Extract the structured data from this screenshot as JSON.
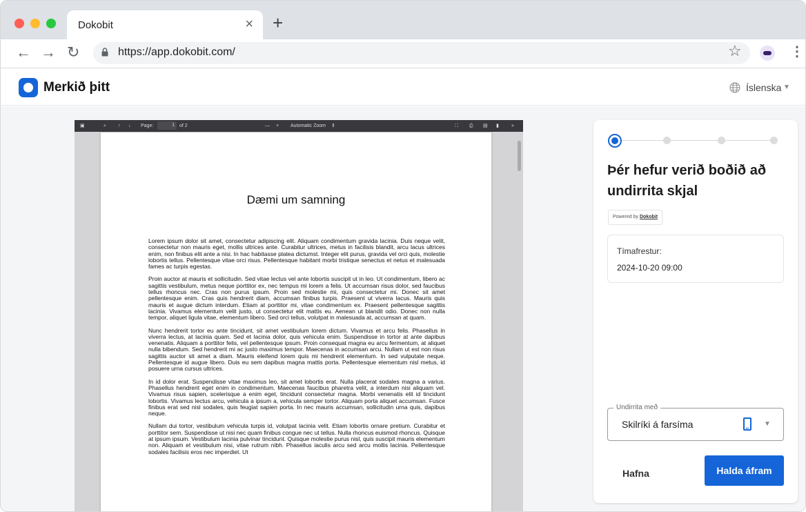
{
  "browser": {
    "tab_title": "Dokobit",
    "tab_close_icon": "close-icon",
    "new_tab_icon": "plus-icon",
    "url": "https://app.dokobit.com/",
    "nav": {
      "back": "←",
      "forward": "→",
      "reload": "↻"
    },
    "star": "☆",
    "menu": "⋮"
  },
  "app": {
    "logo_text": "Merkið þitt",
    "language": "Íslenska"
  },
  "pdf_toolbar": {
    "page_label": "Page:",
    "page_number": "1",
    "page_total": "of 2",
    "zoom_minus": "—",
    "zoom_plus": "+",
    "zoom_label": "Automatic Zoom",
    "more": "»"
  },
  "document": {
    "title": "Dæmi um samning",
    "paragraphs": [
      "Lorem ipsum dolor sit amet, consectetur adipiscing elit. Aliquam condimentum gravida lacinia. Duis neque velit, consectetur non mauris eget, mollis ultrices ante. Curabitur ultrices, metus in facilisis blandit, arcu lacus ultrices enim, non finibus elit ante a nisi. In hac habitasse platea dictumst. Integer elit purus, gravida vel orci quis, molestie lobortis tellus. Pellentesque vitae orci risus. Pellentesque habitant morbi tristique senectus et netus et malesuada fames ac turpis egestas.",
      "Proin auctor at mauris et sollicitudin. Sed vitae lectus vel ante lobortis suscipit ut in leo. Ut condimentum, libero ac sagittis vestibulum, metus neque porttitor ex, nec tempus mi lorem a felis. Ut accumsan risus dolor, sed faucibus tellus rhoncus nec. Cras non purus ipsum. Proin sed molestie mi, quis consectetur mi. Donec sit amet pellentesque enim. Cras quis hendrerit diam, accumsan finibus turpis. Praesent ut viverra lacus. Mauris quis mauris et augue dictum interdum. Etiam at porttitor mi, vitae condimentum ex. Praesent pellentesque sagittis lacinia. Vivamus elementum velit justo, ut consectetur elit mattis eu. Aenean ut blandit odio. Donec non nulla tempor, aliquet ligula vitae, elementum libero. Sed orci tellus, volutpat in malesuada at, accumsan at quam.",
      "Nunc hendrerit tortor eu ante tincidunt, sit amet vestibulum lorem dictum. Vivamus et arcu felis. Phasellus in viverra lectus, at lacinia quam. Sed et lacinia dolor, quis vehicula enim. Suspendisse in tortor at ante dapibus venenatis. Aliquam a porttitor felis, vel pellentesque ipsum. Proin consequat magna eu arcu fermentum, at aliquet nulla bibendum. Sed hendrerit mi ac justo maximus tempor. Maecenas in accumsan arcu. Nullam ut est non risus sagittis auctor sit amet a diam. Mauris eleifend lorem quis mi hendrerit elementum. In sed vulputate neque. Pellentesque id augue libero. Duis eu sem dapibus magna mattis porta. Pellentesque elementum nisl metus, id posuere urna cursus ultrices.",
      "In id dolor erat. Suspendisse vitae maximus leo, sit amet lobortis erat. Nulla placerat sodales magna a varius. Phasellus hendrerit eget enim in condimentum. Maecenas faucibus pharetra velit, a interdum nisi aliquam vel. Vivamus risus sapien, scelerisque a enim eget, tincidunt consectetur magna. Morbi venenatis elit id tincidunt lobortis. Vivamus lectus arcu, vehicula a ipsum a, vehicula semper tortor. Aliquam porta aliquet accumsan. Fusce finibus erat sed nisl sodales, quis feugiat sapien porta. In nec mauris accumsan, sollicitudin urna quis, dapibus neque.",
      "Nullam dui tortor, vestibulum vehicula turpis id, volutpat lacinia velit. Etiam lobortis ornare pretium. Curabitur et porttitor sem. Suspendisse ut nisi nec quam finibus congue nec ut tellus. Nulla rhoncus euismod rhoncus. Quisque at ipsum ipsum. Vestibulum lacinia pulvinar tincidunt. Quisque molestie purus nisl, quis suscipit mauris elementum non. Aliquam et vestibulum nisi, vitae rutrum nibh. Phasellus iaculis arcu sed arcu mollis lacinia. Pellentesque sodales facilisis eros nec imperdiet. Ut"
    ]
  },
  "signing_panel": {
    "title": "Þér hefur verið boðið að undirrita skjal",
    "powered_by": "Powered by",
    "powered_brand": "Dokobit",
    "deadline_label": "Tímafrestur:",
    "deadline_value": "2024-10-20 09:00",
    "method_legend": "Undirrita með",
    "method_value": "Skilríki á farsíma",
    "decline_label": "Hafna",
    "continue_label": "Halda áfram",
    "accent_color": "#1565d8"
  }
}
